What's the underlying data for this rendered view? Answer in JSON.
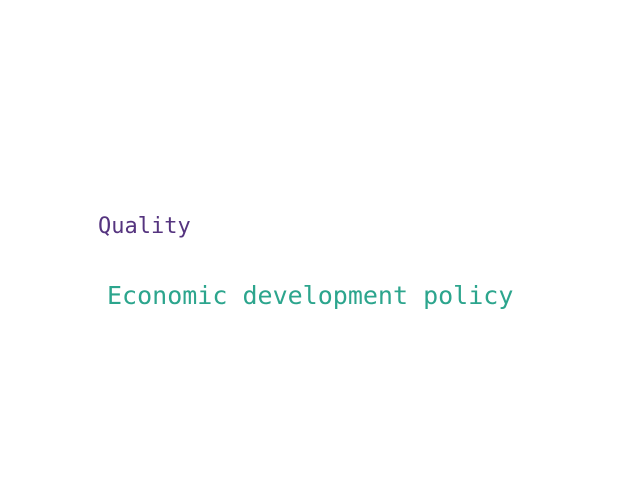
{
  "words": [
    {
      "text": "Quality",
      "color": "#55347f"
    },
    {
      "text": "Economic development policy",
      "color": "#2ca58d"
    }
  ]
}
